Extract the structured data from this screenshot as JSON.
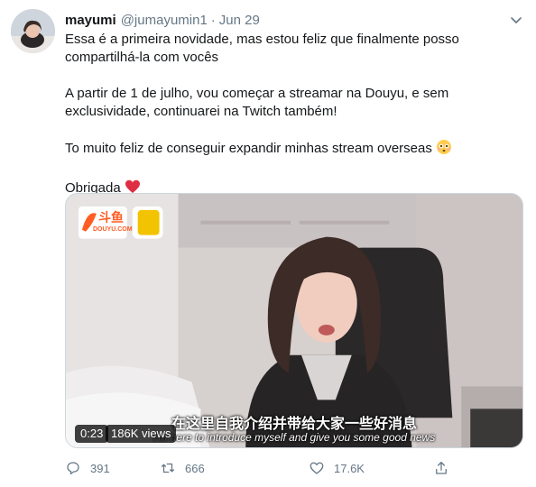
{
  "user": {
    "name": "mayumi",
    "handle": "@jumayumin1",
    "separator": "·",
    "date": "Jun 29"
  },
  "tweet": {
    "paragraphs": [
      "Essa é a primeira novidade, mas estou feliz que finalmente posso compartilhá-la com vocês",
      "A partir de 1 de julho, vou começar a streamar na Douyu, e sem exclusividade, continuarei na Twitch também!",
      "To muito feliz de conseguir expandir minhas stream overseas",
      "Obrigada"
    ],
    "emojis": [
      "flushed-face-emoji",
      "red-heart-emoji"
    ]
  },
  "video": {
    "logo_text": "DOUYU.COM",
    "logo_cn": "斗鱼",
    "subtitle_cn": "在这里自我介绍并带给大家一些好消息",
    "subtitle_en": "I'm here to introduce myself and give you some good news",
    "time": "0:23",
    "views": "186K views"
  },
  "actions": {
    "reply_count": "391",
    "retweet_count": "666",
    "like_count": "17.6K"
  },
  "colors": {
    "text": "#14171a",
    "secondary": "#657786",
    "heart": "#e0245e",
    "douyu_orange": "#ff5d23"
  }
}
